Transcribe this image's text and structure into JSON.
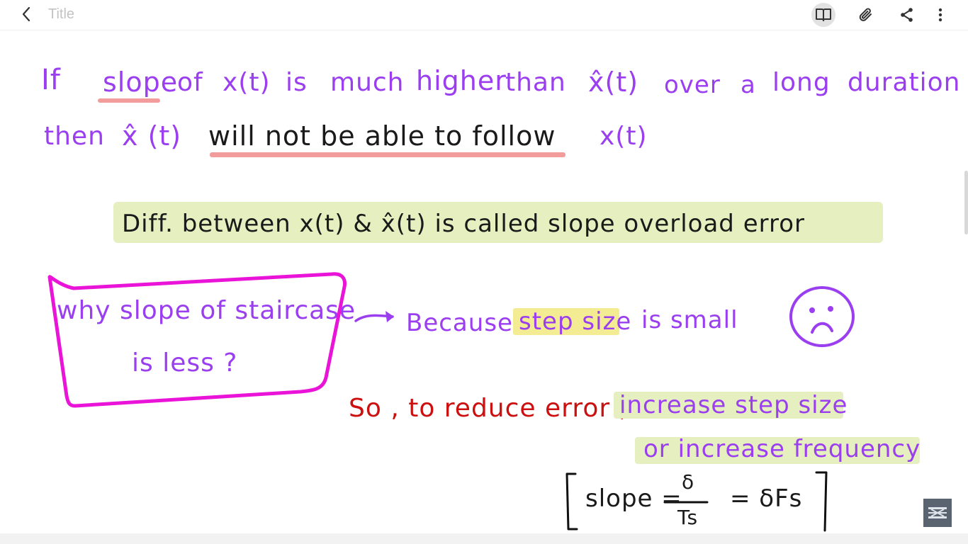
{
  "toolbar": {
    "title": "Title",
    "back_icon": "chevron-left-icon",
    "actions": [
      {
        "name": "reading-mode",
        "icon": "book-icon"
      },
      {
        "name": "attach",
        "icon": "paperclip-icon"
      },
      {
        "name": "share",
        "icon": "share-icon"
      },
      {
        "name": "more",
        "icon": "more-vertical-icon"
      }
    ]
  },
  "note": {
    "line1": {
      "w_if": "If",
      "w_slope": "slope",
      "w_of": "of",
      "w_xt": "x(t)",
      "w_is": "is",
      "w_much": "much",
      "w_higher": "higher",
      "w_than": "than",
      "w_xhat": "x̂(t)",
      "w_over": "over",
      "w_a": "a",
      "w_long": "long",
      "w_duration": "duration"
    },
    "line2": {
      "w_then": "then",
      "w_xhat": "x̂ (t)",
      "w_will_not": "will not be able to follow",
      "w_xt": "x(t)"
    },
    "definition": "Diff. between   x(t) & x̂(t)  is called  slope  overload  error",
    "question_line1": "why slope of staircase",
    "question_line2": "is  less ?",
    "because": "Because",
    "step_size": "step size",
    "is_small": "is  small",
    "so_reduce": "So , to reduce error ,",
    "increase_step": "increase step size",
    "or_increase_freq": "or  increase frequency",
    "formula": {
      "lhs": "slope =",
      "num": "δ",
      "den": "Ts",
      "rhs": "= δFs"
    }
  },
  "colors": {
    "purple": "#9a3ef0",
    "magenta_box": "#ea14d8",
    "red": "#cc1010",
    "green_highlight": "#e6efbf",
    "yellow_highlight": "#f4ec92",
    "pink_underline": "#f39c9c"
  }
}
